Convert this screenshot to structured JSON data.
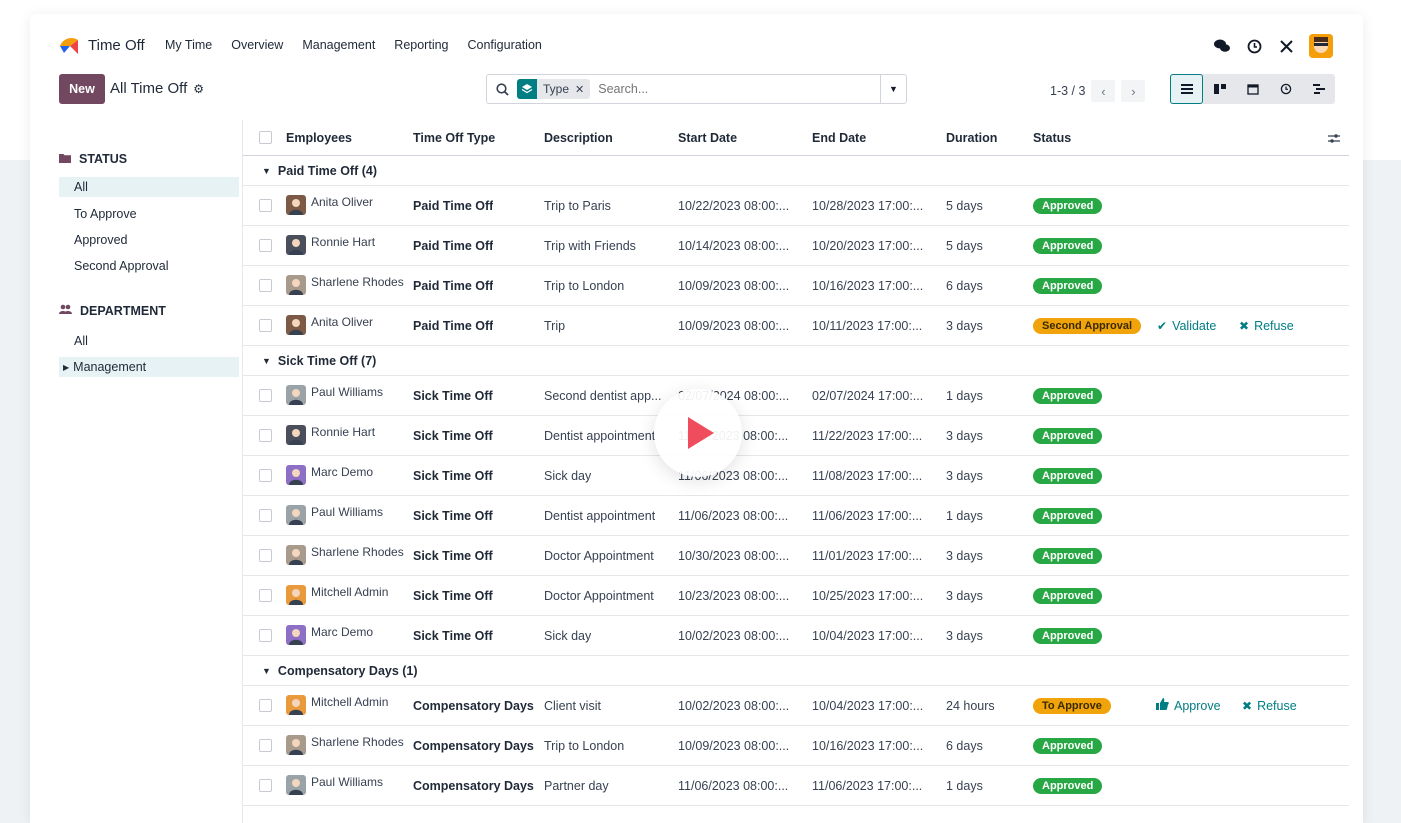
{
  "app": {
    "title": "Time Off",
    "menu": [
      "My Time",
      "Overview",
      "Management",
      "Reporting",
      "Configuration"
    ]
  },
  "control": {
    "new_label": "New",
    "breadcrumb": "All Time Off",
    "search_facet": "Type",
    "search_placeholder": "Search...",
    "pager": "1-3 / 3"
  },
  "sidebar": {
    "status_title": "STATUS",
    "status_items": [
      "All",
      "To Approve",
      "Approved",
      "Second Approval"
    ],
    "department_title": "DEPARTMENT",
    "department_items": [
      "All",
      "Management"
    ]
  },
  "table": {
    "headers": [
      "Employees",
      "Time Off Type",
      "Description",
      "Start Date",
      "End Date",
      "Duration",
      "Status"
    ],
    "groups": [
      {
        "label": "Paid Time Off (4)",
        "rows": [
          {
            "employee": "Anita Oliver",
            "type": "Paid Time Off",
            "description": "Trip to Paris",
            "start": "10/22/2023 08:00:...",
            "end": "10/28/2023 17:00:...",
            "duration": "5 days",
            "status": "Approved"
          },
          {
            "employee": "Ronnie Hart",
            "type": "Paid Time Off",
            "description": "Trip with Friends",
            "start": "10/14/2023 08:00:...",
            "end": "10/20/2023 17:00:...",
            "duration": "5 days",
            "status": "Approved"
          },
          {
            "employee": "Sharlene Rhodes",
            "type": "Paid Time Off",
            "description": "Trip to London",
            "start": "10/09/2023 08:00:...",
            "end": "10/16/2023 17:00:...",
            "duration": "6 days",
            "status": "Approved"
          },
          {
            "employee": "Anita Oliver",
            "type": "Paid Time Off",
            "description": "Trip",
            "start": "10/09/2023 08:00:...",
            "end": "10/11/2023 17:00:...",
            "duration": "3 days",
            "status": "Second Approval",
            "action1": "Validate",
            "action2": "Refuse"
          }
        ]
      },
      {
        "label": "Sick Time Off (7)",
        "rows": [
          {
            "employee": "Paul Williams",
            "type": "Sick Time Off",
            "description": "Second dentist app...",
            "start": "02/07/2024 08:00:...",
            "end": "02/07/2024 17:00:...",
            "duration": "1 days",
            "status": "Approved"
          },
          {
            "employee": "Ronnie Hart",
            "type": "Sick Time Off",
            "description": "Dentist appointment",
            "start": "11/20/2023 08:00:...",
            "end": "11/22/2023 17:00:...",
            "duration": "3 days",
            "status": "Approved"
          },
          {
            "employee": "Marc Demo",
            "type": "Sick Time Off",
            "description": "Sick day",
            "start": "11/06/2023 08:00:...",
            "end": "11/08/2023 17:00:...",
            "duration": "3 days",
            "status": "Approved"
          },
          {
            "employee": "Paul Williams",
            "type": "Sick Time Off",
            "description": "Dentist appointment",
            "start": "11/06/2023 08:00:...",
            "end": "11/06/2023 17:00:...",
            "duration": "1 days",
            "status": "Approved"
          },
          {
            "employee": "Sharlene Rhodes",
            "type": "Sick Time Off",
            "description": "Doctor Appointment",
            "start": "10/30/2023 08:00:...",
            "end": "11/01/2023 17:00:...",
            "duration": "3 days",
            "status": "Approved"
          },
          {
            "employee": "Mitchell Admin",
            "type": "Sick Time Off",
            "description": "Doctor Appointment",
            "start": "10/23/2023 08:00:...",
            "end": "10/25/2023 17:00:...",
            "duration": "3 days",
            "status": "Approved"
          },
          {
            "employee": "Marc Demo",
            "type": "Sick Time Off",
            "description": "Sick day",
            "start": "10/02/2023 08:00:...",
            "end": "10/04/2023 17:00:...",
            "duration": "3 days",
            "status": "Approved"
          }
        ]
      },
      {
        "label": "Compensatory Days (1)",
        "rows": [
          {
            "employee": "Mitchell Admin",
            "type": "Compensatory Days",
            "description": "Client visit",
            "start": "10/02/2023 08:00:...",
            "end": "10/04/2023 17:00:...",
            "duration": "24 hours",
            "status": "To Approve",
            "action1": "Approve",
            "action2": "Refuse"
          },
          {
            "employee": "Sharlene Rhodes",
            "type": "Compensatory Days",
            "description": "Trip to London",
            "start": "10/09/2023 08:00:...",
            "end": "10/16/2023 17:00:...",
            "duration": "6 days",
            "status": "Approved"
          },
          {
            "employee": "Paul Williams",
            "type": "Compensatory Days",
            "description": "Partner day",
            "start": "11/06/2023 08:00:...",
            "end": "11/06/2023 17:00:...",
            "duration": "1 days",
            "status": "Approved"
          }
        ]
      }
    ]
  },
  "colors": {
    "brand": "#71485f",
    "accent": "#017e84",
    "approved": "#28a745",
    "pending": "#f0a30a"
  },
  "avatars": {
    "Anita Oliver": "#7c5a45",
    "Ronnie Hart": "#4b4f5c",
    "Sharlene Rhodes": "#a89b8c",
    "Paul Williams": "#9aa3a8",
    "Marc Demo": "#8d6fc6",
    "Mitchell Admin": "#e89a3c"
  }
}
